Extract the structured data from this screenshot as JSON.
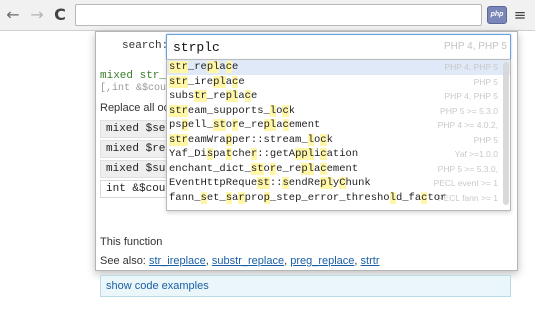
{
  "toolbar": {
    "back_glyph": "←",
    "forward_glyph": "→",
    "reload_glyph": "C",
    "extension_label": "php",
    "menu_glyph": "≡",
    "address_value": ""
  },
  "search": {
    "label": "search:",
    "value": "strplc",
    "version": "PHP 4, PHP 5"
  },
  "doc": {
    "signature_line1": "mixed str_r",
    "signature_line2": "[,int &$cou",
    "description": "Replace all oc",
    "params": [
      "mixed $sear",
      "mixed $repl",
      "mixed $sub",
      "int &$count"
    ],
    "function_text": "This function",
    "see_also_label": "See also:",
    "see_also_links": [
      "str_ireplace",
      "substr_replace",
      "preg_replace",
      "strtr"
    ],
    "examples_label": "show code examples"
  },
  "suggestions": [
    {
      "parts": [
        [
          "str",
          "y"
        ],
        [
          "_re",
          ""
        ],
        [
          "pl",
          "y"
        ],
        [
          "a",
          ""
        ],
        [
          "c",
          "y"
        ],
        [
          "e",
          ""
        ]
      ],
      "version": "PHP 4, PHP 5"
    },
    {
      "parts": [
        [
          "str",
          "y"
        ],
        [
          "_ire",
          ""
        ],
        [
          "pl",
          "y"
        ],
        [
          "a",
          ""
        ],
        [
          "c",
          "y"
        ],
        [
          "e",
          ""
        ]
      ],
      "version": "PHP 5"
    },
    {
      "parts": [
        [
          "subs",
          ""
        ],
        [
          "tr",
          "y"
        ],
        [
          "_re",
          ""
        ],
        [
          "pl",
          "y"
        ],
        [
          "a",
          ""
        ],
        [
          "c",
          "y"
        ],
        [
          "e",
          ""
        ]
      ],
      "version": "PHP 4, PHP 5"
    },
    {
      "parts": [
        [
          "s",
          "y"
        ],
        [
          "tr",
          "y"
        ],
        [
          "eam_supports_",
          ""
        ],
        [
          "l",
          "y"
        ],
        [
          "o",
          ""
        ],
        [
          "c",
          "y"
        ],
        [
          "k",
          ""
        ]
      ],
      "version": "PHP 5 >= 5.3.0"
    },
    {
      "parts": [
        [
          "ps",
          ""
        ],
        [
          "p",
          "y"
        ],
        [
          "ell_",
          ""
        ],
        [
          "st",
          "y"
        ],
        [
          "o",
          ""
        ],
        [
          "r",
          "y"
        ],
        [
          "e_re",
          ""
        ],
        [
          "pl",
          "y"
        ],
        [
          "a",
          ""
        ],
        [
          "c",
          "y"
        ],
        [
          "ement",
          ""
        ]
      ],
      "version": "PHP 4 >= 4.0.2,"
    },
    {
      "parts": [
        [
          "str",
          "y"
        ],
        [
          "eamWra",
          ""
        ],
        [
          "p",
          "y"
        ],
        [
          "per::stream_",
          ""
        ],
        [
          "l",
          "y"
        ],
        [
          "o",
          ""
        ],
        [
          "c",
          "y"
        ],
        [
          "k",
          ""
        ]
      ],
      "version": "PHP 5"
    },
    {
      "parts": [
        [
          "Yaf_Di",
          ""
        ],
        [
          "s",
          "y"
        ],
        [
          "pa",
          ""
        ],
        [
          "t",
          "y"
        ],
        [
          "che",
          ""
        ],
        [
          "r",
          "y"
        ],
        [
          "::getA",
          ""
        ],
        [
          "ppl",
          "y"
        ],
        [
          "i",
          ""
        ],
        [
          "c",
          "y"
        ],
        [
          "ation",
          ""
        ]
      ],
      "version": "Yaf >=1.0.0"
    },
    {
      "parts": [
        [
          "enchant_dict_",
          ""
        ],
        [
          "st",
          "y"
        ],
        [
          "o",
          ""
        ],
        [
          "r",
          "y"
        ],
        [
          "e_re",
          ""
        ],
        [
          "pl",
          "y"
        ],
        [
          "a",
          ""
        ],
        [
          "c",
          "y"
        ],
        [
          "ement",
          ""
        ]
      ],
      "version": "PHP 5 >= 5.3.0,"
    },
    {
      "parts": [
        [
          "EventHttpReque",
          ""
        ],
        [
          "st",
          "y"
        ],
        [
          "::",
          ""
        ],
        [
          "s",
          "y"
        ],
        [
          "endRe",
          ""
        ],
        [
          "pl",
          "y"
        ],
        [
          "y",
          ""
        ],
        [
          "C",
          "y"
        ],
        [
          "hunk",
          ""
        ]
      ],
      "version": "PECL event >= 1"
    },
    {
      "parts": [
        [
          "fann_",
          ""
        ],
        [
          "s",
          "y"
        ],
        [
          "et_",
          ""
        ],
        [
          "s",
          "y"
        ],
        [
          "a",
          ""
        ],
        [
          "r",
          "y"
        ],
        [
          "pro",
          ""
        ],
        [
          "p",
          "y"
        ],
        [
          "_step_error_thresho",
          ""
        ],
        [
          "l",
          "y"
        ],
        [
          "d_fa",
          ""
        ],
        [
          "c",
          "y"
        ],
        [
          "tor",
          ""
        ]
      ],
      "version": "PECL fann >= 1"
    }
  ],
  "colors": {
    "highlight": "#fff6a8",
    "selected_row": "#dfe9f7",
    "link": "#1a5fa6",
    "signature": "#3a7c2a"
  }
}
